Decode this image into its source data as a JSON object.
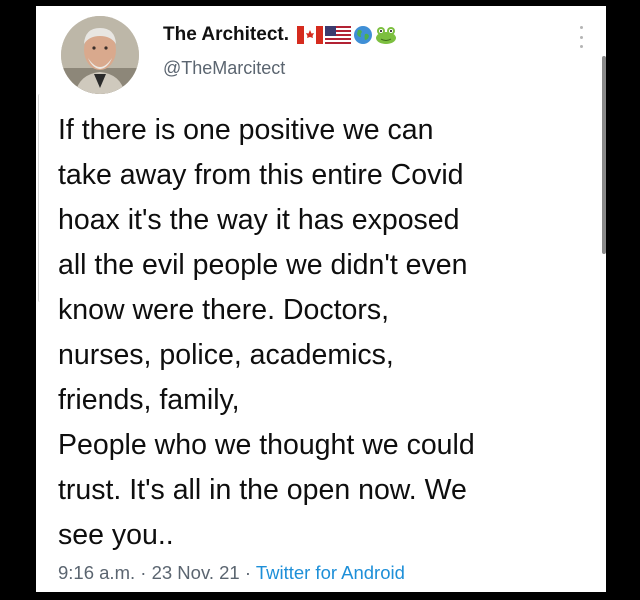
{
  "author": {
    "display_name": "The Architect.",
    "handle": "@TheMarcitect",
    "badges": [
      "canada-flag-icon",
      "usa-flag-icon",
      "globe-icon",
      "frog-icon"
    ]
  },
  "tweet": {
    "lines": [
      "If there is one positive we can",
      "take away from this entire Covid",
      "hoax it's the way it has exposed",
      "all the evil people we didn't even",
      "know were there. Doctors,",
      "nurses, police, academics,",
      "friends, family,",
      "People who we thought we could",
      "trust. It's all in the open now. We",
      "see you.."
    ]
  },
  "meta": {
    "time": "9:16 a.m.",
    "separator1": " · ",
    "date": "23 Nov. 21",
    "separator2": " · ",
    "source": "Twitter for Android"
  },
  "colors": {
    "link": "#1d8fd8",
    "secondary_text": "#5b6570",
    "background": "#000000"
  }
}
